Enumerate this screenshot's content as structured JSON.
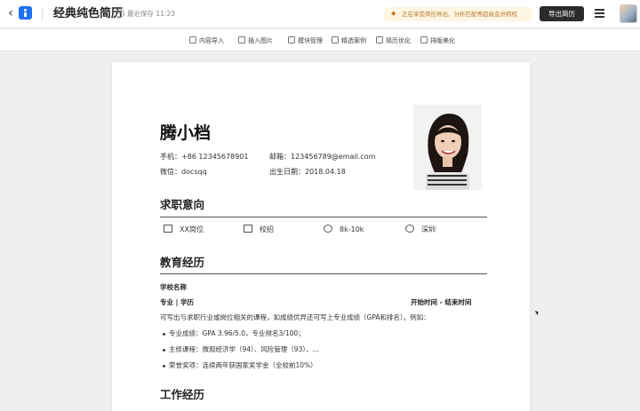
{
  "header": {
    "title": "经典纯色简历",
    "save_status": "最近保存 11:23",
    "promo_text": "正在享受简历导出、分析匹配等超级会员特权",
    "export_label": "导出简历"
  },
  "toolbar": {
    "items": [
      {
        "label": "内容导入",
        "icon": "import-icon"
      },
      {
        "label": "插入图片",
        "icon": "image-icon"
      },
      {
        "label": "模块管理",
        "icon": "modules-icon"
      },
      {
        "label": "精选案例",
        "icon": "examples-icon"
      },
      {
        "label": "简历优化",
        "icon": "optimize-icon"
      },
      {
        "label": "排版美化",
        "icon": "beautify-icon"
      }
    ]
  },
  "resume": {
    "name": "腾小档",
    "phone": "手机：+86 12345678901",
    "email": "邮箱：123456789@email.com",
    "wechat": "微信：docsqq",
    "birth": "出生日期：2018.04.18",
    "sections": {
      "intent_title": "求职意向",
      "education_title": "教育经历",
      "work_title": "工作经历"
    },
    "intent": {
      "position": "XX岗位",
      "type": "校招",
      "salary": "8k-10k",
      "city": "深圳"
    },
    "education": {
      "school": "学校名称",
      "major": "专业 | 学历",
      "period": "开始时间 - 结束时间",
      "description": "可写出与求职行业或岗位相关的课程，如成绩优异还可写上专业成绩（GPA和排名）。例如：",
      "bullets": [
        "专业成绩：GPA 3.96/5.0，专业排名3/100；",
        "主修课程：微观经济学（94）、风险管理（93）、...",
        "荣誉奖项：连续两年获国家奖学金（全校前10%）"
      ]
    }
  }
}
